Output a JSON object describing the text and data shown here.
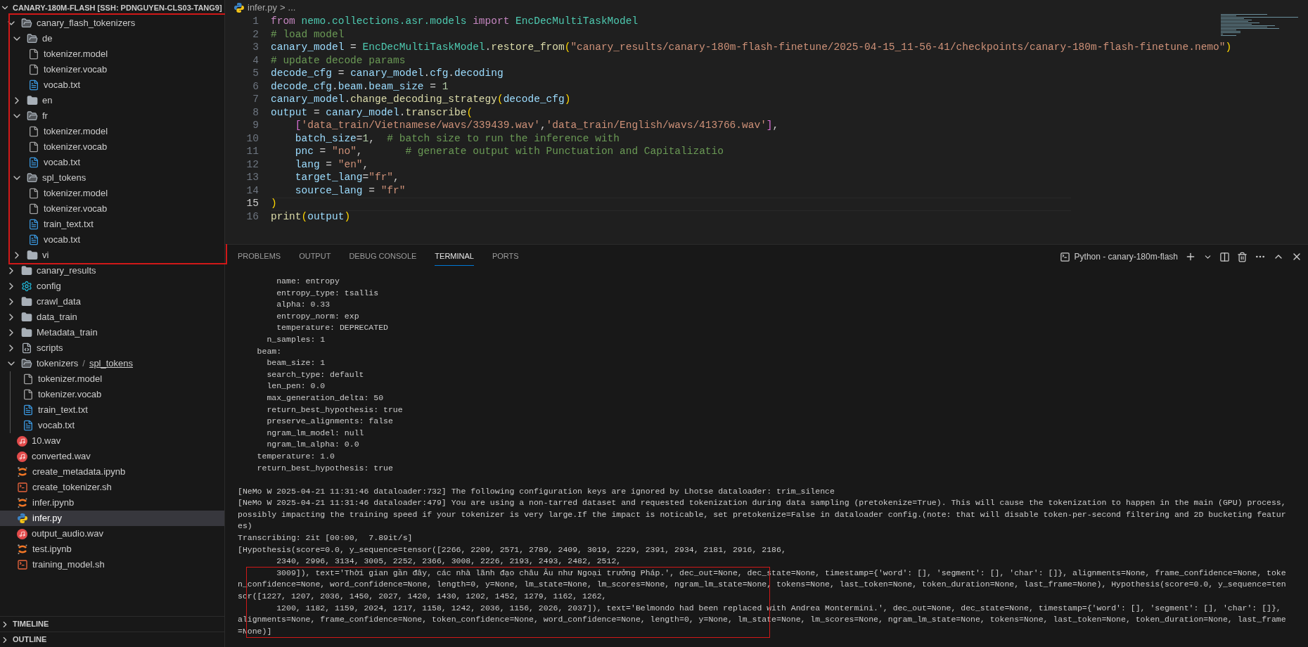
{
  "explorer": {
    "root": {
      "label": "CANARY-180M-FLASH [SSH: PDNGUYEN-CLS03-TANG9]",
      "expanded": true
    },
    "items": [
      {
        "label": "canary_flash_tokenizers",
        "kind": "folder",
        "expanded": true,
        "selected": false,
        "outlined": true,
        "children": [
          {
            "label": "de",
            "kind": "folder",
            "expanded": true,
            "selected": false,
            "children": [
              {
                "label": "tokenizer.model",
                "kind": "file",
                "selected": false
              },
              {
                "label": "tokenizer.vocab",
                "kind": "file",
                "selected": false
              },
              {
                "label": "vocab.txt",
                "kind": "text",
                "selected": false
              }
            ]
          },
          {
            "label": "en",
            "kind": "folder",
            "expanded": false,
            "selected": false
          },
          {
            "label": "fr",
            "kind": "folder",
            "expanded": true,
            "selected": false,
            "children": [
              {
                "label": "tokenizer.model",
                "kind": "file",
                "selected": false
              },
              {
                "label": "tokenizer.vocab",
                "kind": "file",
                "selected": false
              },
              {
                "label": "vocab.txt",
                "kind": "text",
                "selected": false
              }
            ]
          },
          {
            "label": "spl_tokens",
            "kind": "folder",
            "expanded": true,
            "selected": false,
            "children": [
              {
                "label": "tokenizer.model",
                "kind": "file",
                "selected": false
              },
              {
                "label": "tokenizer.vocab",
                "kind": "file",
                "selected": false
              },
              {
                "label": "train_text.txt",
                "kind": "text",
                "selected": false
              },
              {
                "label": "vocab.txt",
                "kind": "text",
                "selected": false
              }
            ]
          },
          {
            "label": "vi",
            "kind": "folder",
            "expanded": false,
            "selected": false
          }
        ]
      },
      {
        "label": "canary_results",
        "kind": "folder",
        "expanded": false,
        "selected": false,
        "outlined": false
      },
      {
        "label": "config",
        "kind": "config",
        "expanded": false,
        "selected": false,
        "outlined": false
      },
      {
        "label": "crawl_data",
        "kind": "folder",
        "expanded": false,
        "selected": false,
        "outlined": false
      },
      {
        "label": "data_train",
        "kind": "folder",
        "expanded": false,
        "selected": false,
        "outlined": false
      },
      {
        "label": "Metadata_train",
        "kind": "folder",
        "expanded": false,
        "selected": false,
        "outlined": false
      },
      {
        "label": "scripts",
        "kind": "scripts",
        "expanded": false,
        "selected": false,
        "outlined": false
      },
      {
        "label": "tokenizers",
        "compact_child": "spl_tokens",
        "separator": "/",
        "kind": "folder",
        "expanded": true,
        "selected": false,
        "outlined": false,
        "children": [
          {
            "label": "tokenizer.model",
            "kind": "file",
            "selected": false
          },
          {
            "label": "tokenizer.vocab",
            "kind": "file",
            "selected": false
          },
          {
            "label": "train_text.txt",
            "kind": "text",
            "selected": false
          },
          {
            "label": "vocab.txt",
            "kind": "text",
            "selected": false
          }
        ]
      },
      {
        "label": "10.wav",
        "kind": "audio",
        "selected": false,
        "outlined": false
      },
      {
        "label": "converted.wav",
        "kind": "audio",
        "selected": false,
        "outlined": false
      },
      {
        "label": "create_metadata.ipynb",
        "kind": "notebook",
        "selected": false,
        "outlined": false
      },
      {
        "label": "create_tokenizer.sh",
        "kind": "shell",
        "selected": false,
        "outlined": false
      },
      {
        "label": "infer.ipynb",
        "kind": "notebook",
        "selected": false,
        "outlined": false
      },
      {
        "label": "infer.py",
        "kind": "python",
        "selected": true,
        "outlined": false
      },
      {
        "label": "output_audio.wav",
        "kind": "audio",
        "selected": false,
        "outlined": false
      },
      {
        "label": "test.ipynb",
        "kind": "notebook",
        "selected": false,
        "outlined": false
      },
      {
        "label": "training_model.sh",
        "kind": "shell",
        "selected": false,
        "outlined": false
      }
    ],
    "sections": [
      {
        "label": "TIMELINE",
        "expanded": false
      },
      {
        "label": "OUTLINE",
        "expanded": false
      }
    ]
  },
  "editor": {
    "breadcrumb": {
      "file": "infer.py",
      "separator": ">",
      "more": "..."
    },
    "lines": [
      {
        "number": "1",
        "current": false,
        "tokens": [
          {
            "text": "from ",
            "kind": "keyword"
          },
          {
            "text": "nemo.collections.asr.models ",
            "kind": "class"
          },
          {
            "text": "import ",
            "kind": "keyword"
          },
          {
            "text": "EncDecMultiTaskModel",
            "kind": "class"
          }
        ]
      },
      {
        "number": "2",
        "current": false,
        "tokens": [
          {
            "text": "# load model",
            "kind": "comment"
          }
        ]
      },
      {
        "number": "3",
        "current": false,
        "tokens": [
          {
            "text": "canary_model",
            "kind": "variable"
          },
          {
            "text": " = ",
            "kind": "plain"
          },
          {
            "text": "EncDecMultiTaskModel",
            "kind": "class"
          },
          {
            "text": ".",
            "kind": "plain"
          },
          {
            "text": "restore_from",
            "kind": "function"
          },
          {
            "text": "(",
            "kind": "bracket1"
          },
          {
            "text": "\"canary_results/canary-180m-flash-finetune/2025-04-15_11-56-41/checkpoints/canary-180m-flash-finetune.nemo\"",
            "kind": "string"
          },
          {
            "text": ")",
            "kind": "bracket1"
          }
        ]
      },
      {
        "number": "4",
        "current": false,
        "tokens": [
          {
            "text": "# update decode params",
            "kind": "comment"
          }
        ]
      },
      {
        "number": "5",
        "current": false,
        "tokens": [
          {
            "text": "decode_cfg",
            "kind": "variable"
          },
          {
            "text": " = ",
            "kind": "plain"
          },
          {
            "text": "canary_model",
            "kind": "variable"
          },
          {
            "text": ".",
            "kind": "plain"
          },
          {
            "text": "cfg",
            "kind": "variable"
          },
          {
            "text": ".",
            "kind": "plain"
          },
          {
            "text": "decoding",
            "kind": "variable"
          }
        ]
      },
      {
        "number": "6",
        "current": false,
        "tokens": [
          {
            "text": "decode_cfg",
            "kind": "variable"
          },
          {
            "text": ".",
            "kind": "plain"
          },
          {
            "text": "beam",
            "kind": "variable"
          },
          {
            "text": ".",
            "kind": "plain"
          },
          {
            "text": "beam_size",
            "kind": "variable"
          },
          {
            "text": " = ",
            "kind": "plain"
          },
          {
            "text": "1",
            "kind": "number"
          }
        ]
      },
      {
        "number": "7",
        "current": false,
        "tokens": [
          {
            "text": "canary_model",
            "kind": "variable"
          },
          {
            "text": ".",
            "kind": "plain"
          },
          {
            "text": "change_decoding_strategy",
            "kind": "function"
          },
          {
            "text": "(",
            "kind": "bracket1"
          },
          {
            "text": "decode_cfg",
            "kind": "variable"
          },
          {
            "text": ")",
            "kind": "bracket1"
          }
        ]
      },
      {
        "number": "8",
        "current": false,
        "tokens": [
          {
            "text": "output",
            "kind": "variable"
          },
          {
            "text": " = ",
            "kind": "plain"
          },
          {
            "text": "canary_model",
            "kind": "variable"
          },
          {
            "text": ".",
            "kind": "plain"
          },
          {
            "text": "transcribe",
            "kind": "function"
          },
          {
            "text": "(",
            "kind": "bracket1"
          }
        ]
      },
      {
        "number": "9",
        "current": false,
        "tokens": [
          {
            "text": "    [",
            "kind": "bracket2"
          },
          {
            "text": "'data_train/Vietnamese/wavs/339439.wav'",
            "kind": "string"
          },
          {
            "text": ",",
            "kind": "plain"
          },
          {
            "text": "'data_train/English/wavs/413766.wav'",
            "kind": "string"
          },
          {
            "text": "]",
            "kind": "bracket2"
          },
          {
            "text": ",",
            "kind": "plain"
          }
        ]
      },
      {
        "number": "10",
        "current": false,
        "tokens": [
          {
            "text": "    batch_size",
            "kind": "variable"
          },
          {
            "text": "=",
            "kind": "plain"
          },
          {
            "text": "1",
            "kind": "number"
          },
          {
            "text": ",  ",
            "kind": "plain"
          },
          {
            "text": "# batch size to run the inference with",
            "kind": "comment"
          }
        ]
      },
      {
        "number": "11",
        "current": false,
        "tokens": [
          {
            "text": "    pnc",
            "kind": "variable"
          },
          {
            "text": " = ",
            "kind": "plain"
          },
          {
            "text": "\"no\"",
            "kind": "string"
          },
          {
            "text": ",       ",
            "kind": "plain"
          },
          {
            "text": "# generate output with Punctuation and Capitalizatio",
            "kind": "comment"
          }
        ]
      },
      {
        "number": "12",
        "current": false,
        "tokens": [
          {
            "text": "    lang",
            "kind": "variable"
          },
          {
            "text": " = ",
            "kind": "plain"
          },
          {
            "text": "\"en\"",
            "kind": "string"
          },
          {
            "text": ",",
            "kind": "plain"
          }
        ]
      },
      {
        "number": "13",
        "current": false,
        "tokens": [
          {
            "text": "    target_lang",
            "kind": "variable"
          },
          {
            "text": "=",
            "kind": "plain"
          },
          {
            "text": "\"fr\"",
            "kind": "string"
          },
          {
            "text": ",",
            "kind": "plain"
          }
        ]
      },
      {
        "number": "14",
        "current": false,
        "tokens": [
          {
            "text": "    source_lang",
            "kind": "variable"
          },
          {
            "text": " = ",
            "kind": "plain"
          },
          {
            "text": "\"fr\"",
            "kind": "string"
          }
        ]
      },
      {
        "number": "15",
        "current": true,
        "tokens": [
          {
            "text": ")",
            "kind": "bracket1"
          }
        ]
      },
      {
        "number": "16",
        "current": false,
        "tokens": [
          {
            "text": "print",
            "kind": "function"
          },
          {
            "text": "(",
            "kind": "bracket1"
          },
          {
            "text": "output",
            "kind": "variable"
          },
          {
            "text": ")",
            "kind": "bracket1"
          }
        ]
      }
    ]
  },
  "panel": {
    "tabs": [
      {
        "label": "PROBLEMS",
        "selected": false
      },
      {
        "label": "OUTPUT",
        "selected": false
      },
      {
        "label": "DEBUG CONSOLE",
        "selected": false
      },
      {
        "label": "TERMINAL",
        "selected": true
      },
      {
        "label": "PORTS",
        "selected": false
      }
    ],
    "terminal_name": "Python - canary-180m-flash",
    "terminal": {
      "outlined": true,
      "blocks": [
        [
          "        name: entropy",
          "        entropy_type: tsallis",
          "        alpha: 0.33",
          "        entropy_norm: exp",
          "        temperature: DEPRECATED",
          "      n_samples: 1",
          "    beam:",
          "      beam_size: 1",
          "      search_type: default",
          "      len_pen: 0.0",
          "      max_generation_delta: 50",
          "      return_best_hypothesis: true",
          "      preserve_alignments: false",
          "      ngram_lm_model: null",
          "      ngram_lm_alpha: 0.0",
          "    temperature: 1.0",
          "    return_best_hypothesis: true"
        ],
        [
          "[NeMo W 2025-04-21 11:31:46 dataloader:732] The following configuration keys are ignored by Lhotse dataloader: trim_silence",
          "[NeMo W 2025-04-21 11:31:46 dataloader:479] You are using a non-tarred dataset and requested tokenization during data sampling (pretokenize=True). This will cause the tokenization to happen in the main (GPU) process,",
          "possibly impacting the training speed if your tokenizer is very large.If the impact is noticable, set pretokenize=False in dataloader config.(note: that will disable token-per-second filtering and 2D bucketing featur",
          "es)",
          "Transcribing: 2it [00:00,  7.89it/s]",
          "[Hypothesis(score=0.0, y_sequence=tensor([2266, 2209, 2571, 2789, 2409, 3019, 2229, 2391, 2934, 2181, 2916, 2186,",
          "        2340, 2996, 3134, 3005, 2252, 2366, 3008, 2226, 2193, 2493, 2482, 2512,",
          "        3009]), text='Thời gian gần đây, các nhà lãnh đạo châu Âu như Ngoại trưởng Pháp.', dec_out=None, dec_state=None, timestamp={'word': [], 'segment': [], 'char': []}, alignments=None, frame_confidence=None, toke",
          "n_confidence=None, word_confidence=None, length=0, y=None, lm_state=None, lm_scores=None, ngram_lm_state=None, tokens=None, last_token=None, token_duration=None, last_frame=None), Hypothesis(score=0.0, y_sequence=ten",
          "sor([1227, 1207, 2036, 1450, 2027, 1420, 1430, 1202, 1452, 1279, 1162, 1262,",
          "        1200, 1182, 1159, 2024, 1217, 1158, 1242, 2036, 1156, 2026, 2037]), text='Belmondo had been replaced with Andrea Montermini.', dec_out=None, dec_state=None, timestamp={'word': [], 'segment': [], 'char': []},",
          "alignments=None, frame_confidence=None, token_confidence=None, word_confidence=None, length=0, y=None, lm_state=None, lm_scores=None, ngram_lm_state=None, tokens=None, last_token=None, token_duration=None, last_frame",
          "=None)]"
        ]
      ]
    }
  }
}
